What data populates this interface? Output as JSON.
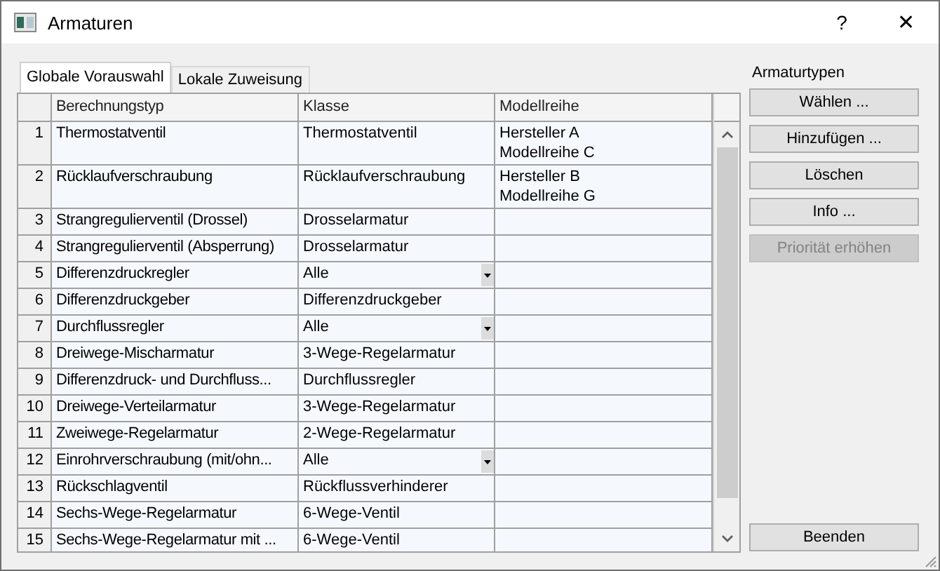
{
  "window": {
    "title": "Armaturen",
    "help": "?",
    "close": "✕"
  },
  "tabs": [
    {
      "label": "Globale Vorauswahl",
      "selected": true
    },
    {
      "label": "Lokale Zuweisung",
      "selected": false
    }
  ],
  "table": {
    "columns": [
      "Berechnungstyp",
      "Klasse",
      "Modellreihe"
    ],
    "rows": [
      {
        "number": "1",
        "typ": "Thermostatventil",
        "klasse": "Thermostatventil",
        "dropdown": false,
        "modellreihe": [
          "Hersteller A",
          "Modellreihe C"
        ]
      },
      {
        "number": "2",
        "typ": "Rücklaufverschraubung",
        "klasse": "Rücklaufverschraubung",
        "dropdown": false,
        "modellreihe": [
          "Hersteller B",
          "Modellreihe G"
        ]
      },
      {
        "number": "3",
        "typ": "Strangregulierventil (Drossel)",
        "klasse": "Drosselarmatur",
        "dropdown": false
      },
      {
        "number": "4",
        "typ": "Strangregulierventil (Absperrung)",
        "klasse": "Drosselarmatur",
        "dropdown": false
      },
      {
        "number": "5",
        "typ": "Differenzdruckregler",
        "klasse": "Alle",
        "dropdown": true
      },
      {
        "number": "6",
        "typ": "Differenzdruckgeber",
        "klasse": "Differenzdruckgeber",
        "dropdown": false
      },
      {
        "number": "7",
        "typ": "Durchflussregler",
        "klasse": "Alle",
        "dropdown": true
      },
      {
        "number": "8",
        "typ": "Dreiwege-Mischarmatur",
        "klasse": "3-Wege-Regelarmatur",
        "dropdown": false
      },
      {
        "number": "9",
        "typ": "Differenzdruck- und Durchfluss...",
        "klasse": "Durchflussregler",
        "dropdown": false
      },
      {
        "number": "10",
        "typ": "Dreiwege-Verteilarmatur",
        "klasse": "3-Wege-Regelarmatur",
        "dropdown": false
      },
      {
        "number": "11",
        "typ": "Zweiwege-Regelarmatur",
        "klasse": "2-Wege-Regelarmatur",
        "dropdown": false
      },
      {
        "number": "12",
        "typ": "Einrohrverschraubung (mit/ohn...",
        "klasse": "Alle",
        "dropdown": true
      },
      {
        "number": "13",
        "typ": "Rückschlagventil",
        "klasse": "Rückflussverhinderer",
        "dropdown": false
      },
      {
        "number": "14",
        "typ": "Sechs-Wege-Regelarmatur",
        "klasse": "6-Wege-Ventil",
        "dropdown": false
      },
      {
        "number": "15",
        "typ": "Sechs-Wege-Regelarmatur mit ...",
        "klasse": "6-Wege-Ventil",
        "dropdown": false
      }
    ]
  },
  "panel": {
    "label": "Armaturtypen",
    "buttons": [
      {
        "label": "Wählen ...",
        "disabled": false
      },
      {
        "label": "Hinzufügen ...",
        "disabled": false
      },
      {
        "label": "Löschen",
        "disabled": false
      },
      {
        "label": "Info ...",
        "disabled": false
      },
      {
        "label": "Priorität erhöhen",
        "disabled": true
      }
    ],
    "exit": "Beenden"
  }
}
